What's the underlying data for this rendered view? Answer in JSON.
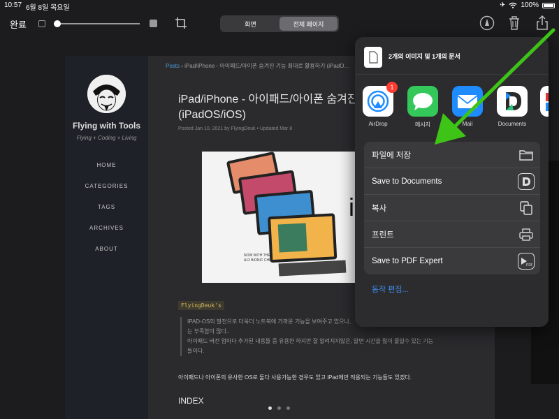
{
  "status": {
    "time": "10:57",
    "date": "6월 8일 목요일",
    "battery": "100%"
  },
  "toolbar": {
    "done_label": "완료",
    "opacity_level": 0.02,
    "segments": [
      {
        "label": "화면",
        "active": false
      },
      {
        "label": "전체 페이지",
        "active": true
      }
    ],
    "icons": [
      "square-outline-icon",
      "slider-knob-icon",
      "square-filled-icon",
      "crop-icon",
      "markup-pen-icon",
      "trash-icon",
      "share-icon"
    ]
  },
  "webpage": {
    "breadcrumb": {
      "root": "Posts",
      "separator": "›",
      "current": "iPad/iPhone - 아이패드/아이폰 숨겨진 기능 최대로 활용하기 (iPadO…"
    },
    "sidebar": {
      "site_title": "Flying with Tools",
      "site_subtitle": "Flying + Coding + Living",
      "nav": [
        "HOME",
        "CATEGORIES",
        "TAGS",
        "ARCHIVES",
        "ABOUT"
      ]
    },
    "title": "iPad/iPhone - 아이패드/아이폰 숨겨진 기능 최대로 활용하기 (iPadOS/iOS)",
    "meta": "Posted Jan 10, 2021 by FlyingDeuk  •  Updated Mar 8",
    "code_tag": "FlyingDeuk's",
    "quote_lines": [
      "IPAD-OS의 발전으로 더욱더 노트북에 가까운 기능을 보여주고 있으나,",
      "는 부족함이 많다..",
      "아이패드 버전 업마다 추가된 내용들 중 유용한 하지만 잘 알려지지않은, 알면 시간을 많이 줄일수 있는 기능",
      "들이다."
    ],
    "paragraph": "아이패드나 아이폰의 유사한 OS로 둘다 사용가능한 경우도 있고 iPad에만 적용되는 기능들도 있겠다.",
    "index_heading": "INDEX"
  },
  "share_sheet": {
    "title": "2개의 이미지 및 1개의 문서",
    "apps": [
      {
        "name": "AirDrop",
        "badge": "1",
        "color": "#ffffff"
      },
      {
        "name": "메시지",
        "color": "#34c759"
      },
      {
        "name": "Mail",
        "color": "#1e8cff"
      },
      {
        "name": "Documents",
        "color": "#ffffff"
      }
    ],
    "actions": [
      {
        "label": "파일에 저장",
        "icon": "folder-icon"
      },
      {
        "label": "Save to Documents",
        "icon": "documents-app-icon"
      },
      {
        "label": "복사",
        "icon": "copy-icon"
      },
      {
        "label": "프린트",
        "icon": "print-icon"
      },
      {
        "label": "Save to PDF Expert",
        "icon": "pdf-expert-icon"
      }
    ],
    "edit_actions": "동작 편집..."
  },
  "annotation": {
    "arrow_color": "#3ec417"
  },
  "pagination": {
    "count": 3,
    "current": 1
  }
}
